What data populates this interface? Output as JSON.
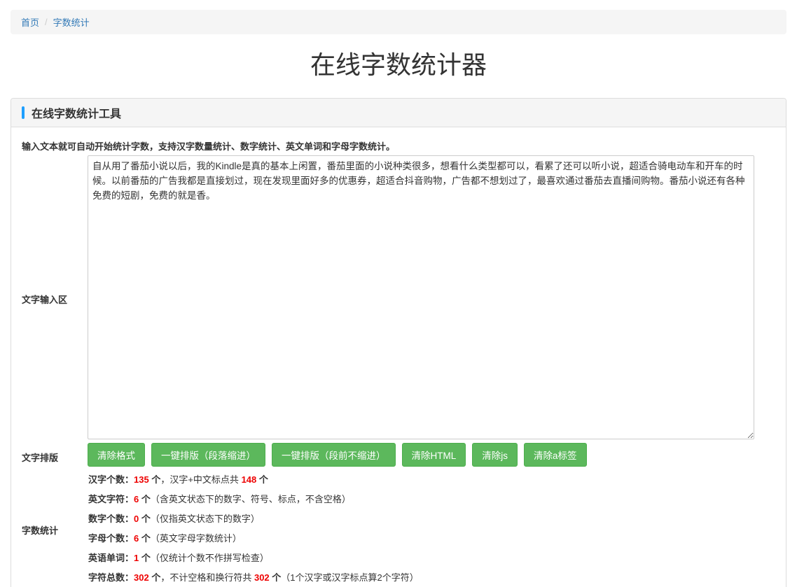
{
  "breadcrumb": {
    "home": "首页",
    "current": "字数统计"
  },
  "page_title": "在线字数统计器",
  "panel": {
    "title": "在线字数统计工具",
    "intro": "输入文本就可自动开始统计字数，支持汉字数量统计、数字统计、英文单词和字母字数统计。",
    "input_label": "文字输入区",
    "input_text": "自从用了番茄小说以后，我的Kindle是真的基本上闲置，番茄里面的小说种类很多，想看什么类型都可以，看累了还可以听小说，超适合骑电动车和开车的时候。以前番茄的广告我都是直接划过，现在发现里面好多的优惠券，超适合抖音购物，广告都不想划过了，最喜欢通过番茄去直播间购物。番茄小说还有各种免费的短剧，免费的就是香。",
    "format_label": "文字排版",
    "buttons": [
      "清除格式",
      "一键排版（段落缩进）",
      "一键排版（段前不缩进）",
      "清除HTML",
      "清除js",
      "清除a标签"
    ],
    "stats_label": "字数统计",
    "stats": {
      "hanzi": {
        "key": "汉字个数：",
        "value": "135",
        "unit": " 个",
        "extra_text": "，汉字+中文标点共 ",
        "extra_value": "148",
        "extra_unit": " 个"
      },
      "english_chars": {
        "key": "英文字符：",
        "value": "6",
        "unit": " 个",
        "note": "（含英文状态下的数字、符号、标点，不含空格）"
      },
      "digits": {
        "key": "数字个数：",
        "value": "0",
        "unit": " 个",
        "note": "（仅指英文状态下的数字）"
      },
      "letters": {
        "key": "字母个数：",
        "value": "6",
        "unit": " 个",
        "note": "（英文字母字数统计）"
      },
      "words": {
        "key": "英语单词：",
        "value": "1",
        "unit": " 个",
        "note": "（仅统计个数不作拼写检查）"
      },
      "total": {
        "key": "字符总数：",
        "value": "302",
        "unit": " 个",
        "extra_text": "，不计空格和换行符共 ",
        "extra_value": "302",
        "extra_unit": " 个",
        "note": "（1个汉字或汉字标点算2个字符）"
      }
    }
  },
  "colors": {
    "button_green": "#5cb85c",
    "accent_blue": "#1e9fff",
    "stat_red": "#e00",
    "link_blue": "#337ab7"
  }
}
